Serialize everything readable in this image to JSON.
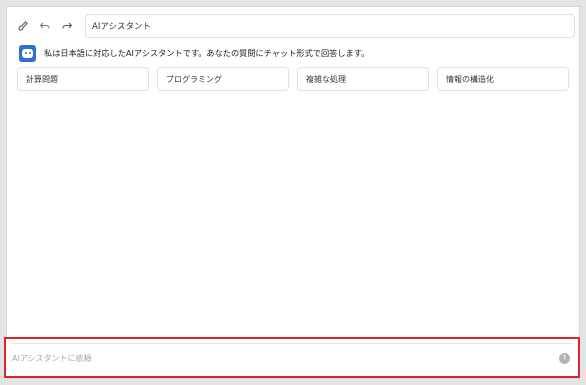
{
  "header": {
    "title": "AIアシスタント",
    "icons": [
      "brush-icon",
      "undo-icon",
      "redo-icon"
    ]
  },
  "intro": {
    "avatar": "robot-avatar-icon",
    "message": "私は日本語に対応したAIアシスタントです。あなたの質問にチャット形式で回答します。"
  },
  "suggestions": [
    {
      "label": "計算問題"
    },
    {
      "label": "プログラミング"
    },
    {
      "label": "複雑な処理"
    },
    {
      "label": "情報の構造化"
    }
  ],
  "chat_input": {
    "placeholder": "AIアシスタントに依頼",
    "value": ""
  },
  "colors": {
    "highlight": "#d9262a",
    "avatar": "#2f6fd6",
    "send_button": "#b5b5b5"
  }
}
